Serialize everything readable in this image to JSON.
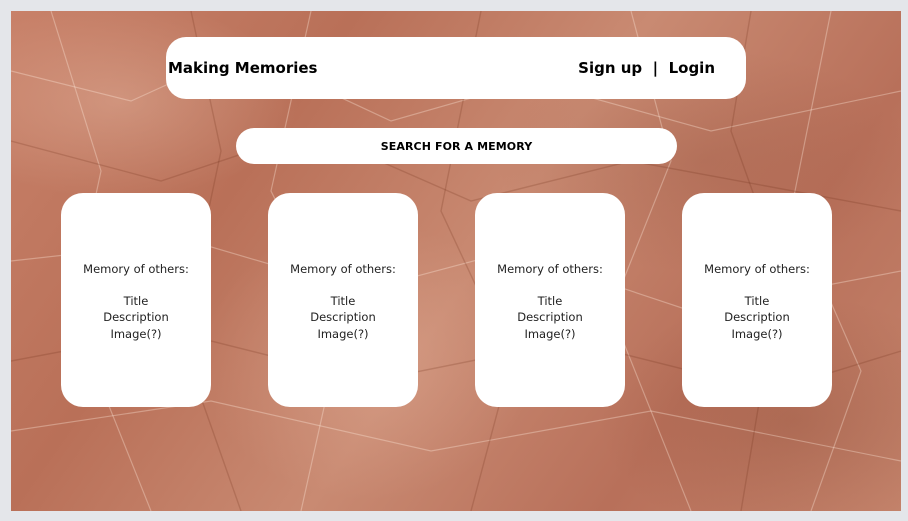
{
  "header": {
    "title": "Making Memories",
    "sign_up": "Sign up",
    "separator": "|",
    "login": "Login"
  },
  "search": {
    "label": "SEARCH FOR A MEMORY"
  },
  "cards": [
    {
      "heading": "Memory of others:",
      "lines": [
        "Title",
        "Description",
        "Image(?)"
      ]
    },
    {
      "heading": "Memory of others:",
      "lines": [
        "Title",
        "Description",
        "Image(?)"
      ]
    },
    {
      "heading": "Memory of others:",
      "lines": [
        "Title",
        "Description",
        "Image(?)"
      ]
    },
    {
      "heading": "Memory of others:",
      "lines": [
        "Title",
        "Description",
        "Image(?)"
      ]
    }
  ],
  "colors": {
    "background": "#c07a62",
    "panel": "#ffffff",
    "frame": "#e4e6ea"
  }
}
